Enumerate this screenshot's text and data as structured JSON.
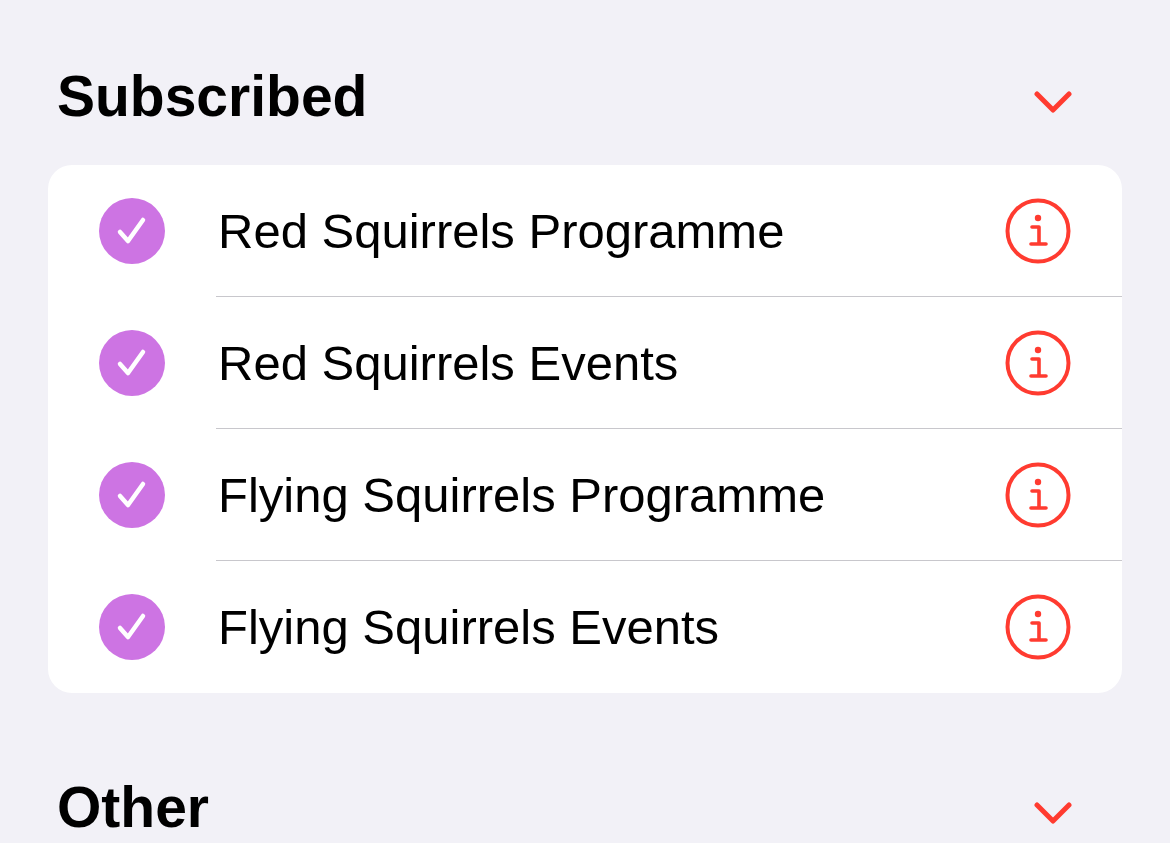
{
  "sections": [
    {
      "title": "Subscribed",
      "calendars": [
        {
          "name": "Red Squirrels Programme",
          "checked": true,
          "color": "#cd74e3"
        },
        {
          "name": "Red Squirrels Events",
          "checked": true,
          "color": "#cd74e3"
        },
        {
          "name": "Flying Squirrels Programme",
          "checked": true,
          "color": "#cd74e3"
        },
        {
          "name": "Flying Squirrels Events",
          "checked": true,
          "color": "#cd74e3"
        }
      ]
    },
    {
      "title": "Other"
    }
  ]
}
